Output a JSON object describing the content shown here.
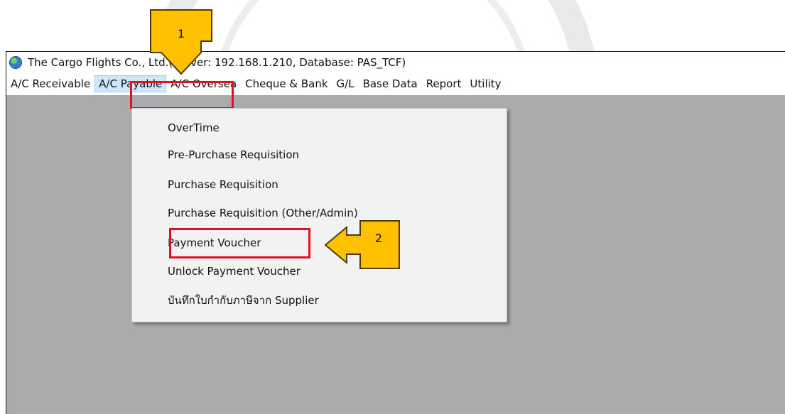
{
  "window": {
    "title": "The Cargo Flights Co., Ltd.(Server: 192.168.1.210,  Database: PAS_TCF)",
    "icon": "globe-icon"
  },
  "menubar": {
    "items": [
      {
        "label": "A/C Receivable"
      },
      {
        "label": "A/C Payable",
        "active": true
      },
      {
        "label": "A/C Oversea"
      },
      {
        "label": "Cheque & Bank"
      },
      {
        "label": "G/L"
      },
      {
        "label": "Base Data"
      },
      {
        "label": "Report"
      },
      {
        "label": "Utility"
      }
    ]
  },
  "dropdown": {
    "items": [
      {
        "label": "OverTime"
      },
      {
        "label": "Pre-Purchase Requisition"
      },
      {
        "label": "Purchase Requisition"
      },
      {
        "label": "Purchase Requisition (Other/Admin)"
      },
      {
        "label": "Payment Voucher",
        "highlighted": true
      },
      {
        "label": "Unlock Payment Voucher"
      },
      {
        "label": "บันทึกใบกำกับภาษีจาก Supplier"
      }
    ]
  },
  "annotations": {
    "step1": "1",
    "step2": "2",
    "callout_color": "#ffc000",
    "highlight_color": "#e5101d"
  },
  "colors": {
    "workspace": "#ababab",
    "menu_active": "#cce8ff"
  }
}
